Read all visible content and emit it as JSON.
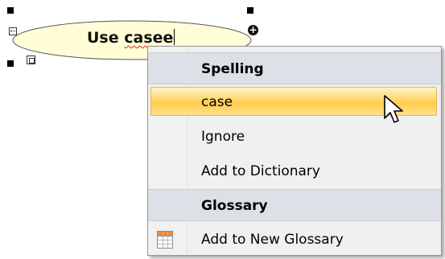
{
  "diagram": {
    "use_case": {
      "label_plain": "Use ",
      "label_misspelled": "casee"
    }
  },
  "context_menu": {
    "spelling_header": "Spelling",
    "suggestion": "case",
    "ignore": "Ignore",
    "add_to_dictionary": "Add to Dictionary",
    "glossary_header": "Glossary",
    "add_to_new_glossary": "Add to New Glossary"
  },
  "colors": {
    "use_case_fill": "#fffed6",
    "highlight": "#ffd76a",
    "header_band": "#dde0e6",
    "misspelling_underline": "#e02020"
  },
  "icons": {
    "add_element": "plus-circle-icon",
    "compartment": "compartment-icon",
    "more": "ellipsis-icon",
    "glossary": "table-grid-icon",
    "cursor": "arrow-cursor-icon"
  }
}
